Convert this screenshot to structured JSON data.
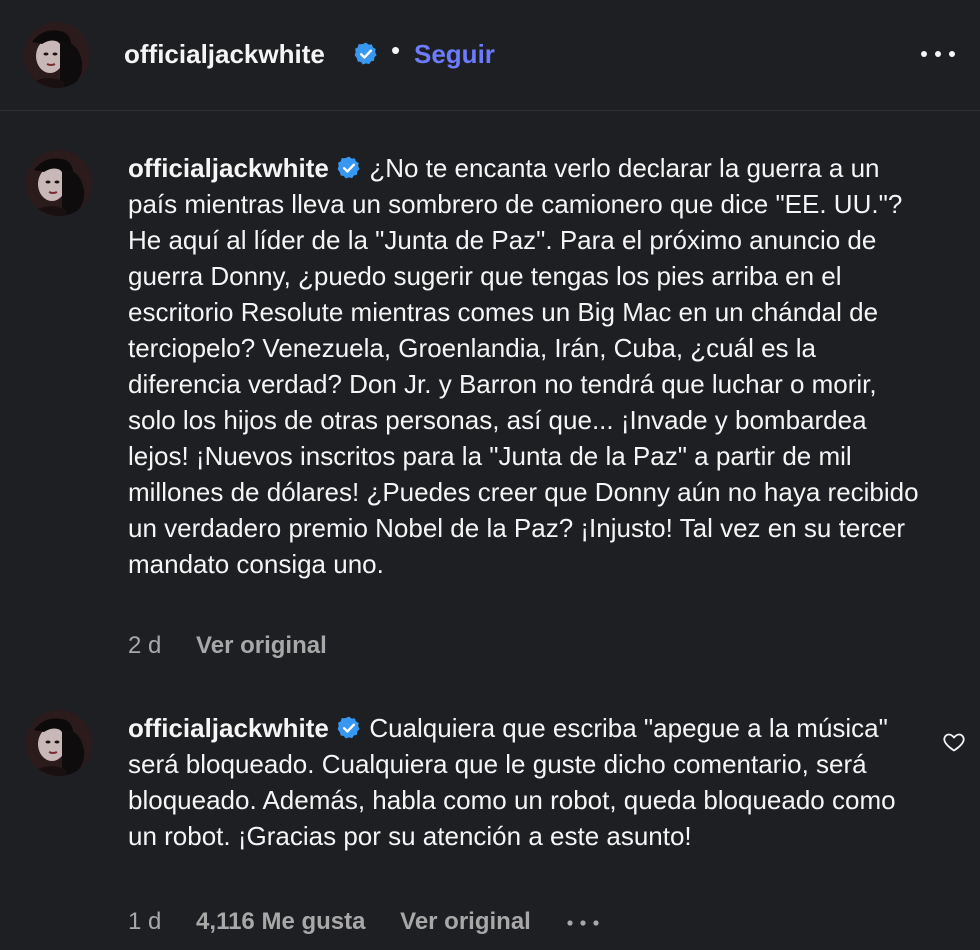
{
  "header": {
    "username": "officialjackwhite",
    "separator": "•",
    "follow_label": "Seguir",
    "more_icon": "more-horizontal-icon"
  },
  "comments": [
    {
      "username": "officialjackwhite",
      "text": "¿No te encanta verlo declarar la guerra a un país mientras lleva un sombrero de camionero que dice \"EE. UU.\"? He aquí al líder de la \"Junta de Paz\". Para el próximo anuncio de guerra Donny, ¿puedo sugerir que tengas los pies arriba en el escritorio Resolute mientras comes un Big Mac en un chándal de terciopelo? Venezuela, Groenlandia, Irán, Cuba, ¿cuál es la diferencia verdad? Don Jr. y Barron no tendrá que luchar o morir, solo los hijos de otras personas, así que... ¡Invade y bombardea lejos! ¡Nuevos inscritos para la \"Junta de la Paz\" a partir de mil millones de dólares! ¿Puedes creer que Donny aún no haya recibido un verdadero premio Nobel de la Paz? ¡Injusto! Tal vez en su tercer mandato consiga uno.",
      "time": "2 d",
      "see_original": "Ver original"
    },
    {
      "username": "officialjackwhite",
      "text": "Cualquiera que escriba \"apegue a la música\" será bloqueado. Cualquiera que le guste dicho comentario, será bloqueado. Además, habla como un robot, queda bloqueado como un robot. ¡Gracias por su atención a este asunto!",
      "time": "1 d",
      "likes": "4,116 Me gusta",
      "see_original": "Ver original"
    }
  ],
  "colors": {
    "background": "#1e1f22",
    "text": "#f5f5f5",
    "muted": "#a8a8a8",
    "link": "#6c7bff",
    "verified": "#3897f0"
  }
}
